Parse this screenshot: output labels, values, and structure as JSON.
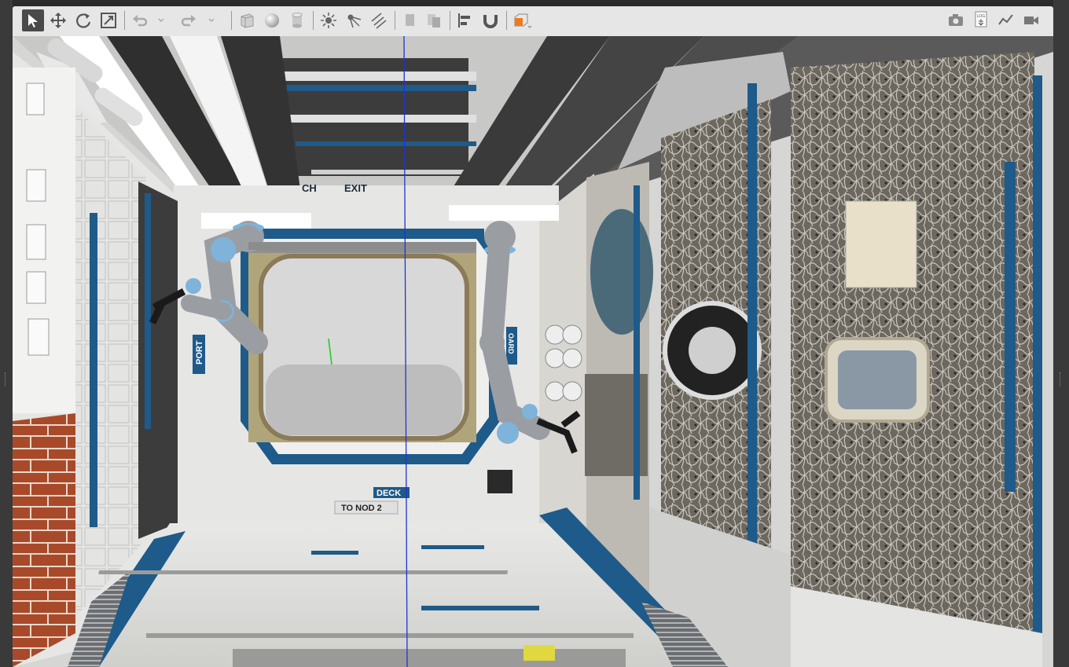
{
  "app": {
    "toolbar": {
      "tools": [
        {
          "name": "select",
          "icon": "arrow-cursor-icon",
          "active": true
        },
        {
          "name": "translate",
          "icon": "move-arrows-icon"
        },
        {
          "name": "rotate",
          "icon": "rotate-icon"
        },
        {
          "name": "scale",
          "icon": "scale-icon"
        },
        {
          "name": "undo",
          "icon": "undo-icon"
        },
        {
          "name": "undo-history",
          "icon": "chevron-down-icon"
        },
        {
          "name": "redo",
          "icon": "redo-icon"
        },
        {
          "name": "redo-history",
          "icon": "chevron-down-icon"
        },
        {
          "name": "box",
          "icon": "box-icon"
        },
        {
          "name": "sphere",
          "icon": "sphere-icon"
        },
        {
          "name": "cylinder",
          "icon": "cylinder-icon"
        },
        {
          "name": "point-light",
          "icon": "sun-icon"
        },
        {
          "name": "spot-light",
          "icon": "spot-light-icon"
        },
        {
          "name": "directional-light",
          "icon": "directional-light-icon"
        },
        {
          "name": "copy",
          "icon": "copy-icon"
        },
        {
          "name": "paste",
          "icon": "paste-icon"
        },
        {
          "name": "align",
          "icon": "align-icon"
        },
        {
          "name": "snap",
          "icon": "magnet-icon"
        },
        {
          "name": "view-angle",
          "icon": "view-cube-icon"
        }
      ],
      "right_tools": [
        {
          "name": "screenshot",
          "icon": "camera-icon"
        },
        {
          "name": "log",
          "icon": "log-icon",
          "label": "LOG"
        },
        {
          "name": "plot",
          "icon": "plot-icon"
        },
        {
          "name": "record-video",
          "icon": "video-camera-icon"
        }
      ]
    },
    "scene": {
      "signs": {
        "exit_top": "EXIT",
        "ch_fragment": "CH",
        "port": "PORT",
        "deck": "DECK",
        "to_node": "TO NOD 2",
        "side_right": "OARD"
      },
      "colors": {
        "blue_trim": "#1e5a8a",
        "panel_white": "#e8e8e6",
        "floor": "#dcdcda",
        "robot_arm": "#9a9ea3",
        "robot_joint": "#7fb3d9",
        "beam_dark": "#3a3a3a",
        "axis_blue": "#2233cc",
        "axis_green": "#22cc22",
        "brick": "#a84a2a"
      }
    }
  }
}
